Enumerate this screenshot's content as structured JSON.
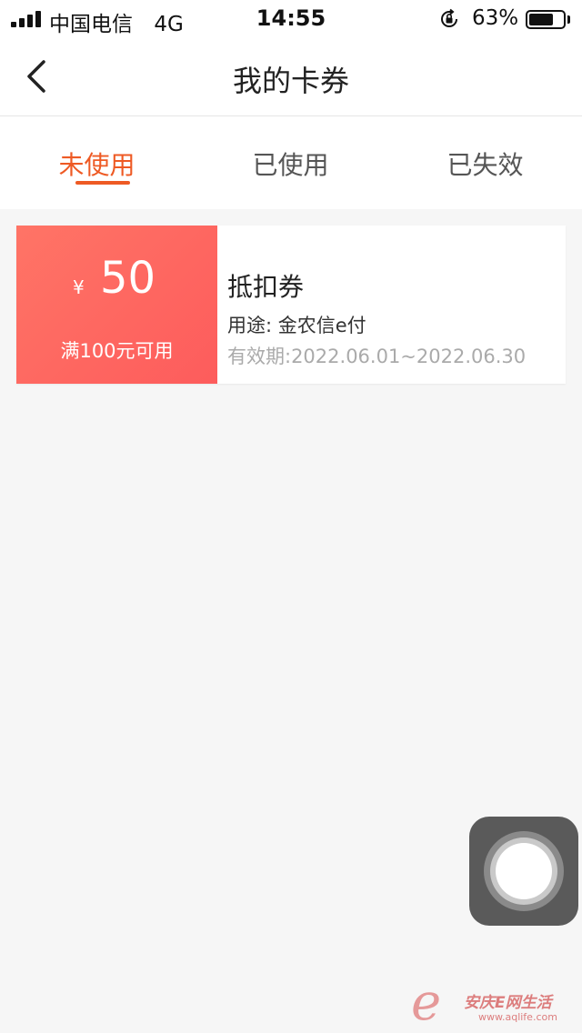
{
  "status_bar": {
    "carrier": "中国电信",
    "network": "4G",
    "time": "14:55",
    "battery": "63%"
  },
  "nav": {
    "title": "我的卡券",
    "back_icon": "chevron-left-icon"
  },
  "tabs": [
    {
      "label": "未使用",
      "active": true
    },
    {
      "label": "已使用",
      "active": false
    },
    {
      "label": "已失效",
      "active": false
    }
  ],
  "coupons": [
    {
      "currency": "¥",
      "amount": "50",
      "condition": "满100元可用",
      "name": "抵扣券",
      "usage": "用途: 金农信e付",
      "validity": "有效期:2022.06.01~2022.06.30"
    }
  ],
  "colors": {
    "accent": "#ee5a24",
    "coupon_start": "#ff7466",
    "coupon_end": "#fd5c5c",
    "background": "#f6f6f6"
  },
  "watermark": {
    "site_name": "安庆E网生活",
    "url": "www.aqlife.com"
  }
}
